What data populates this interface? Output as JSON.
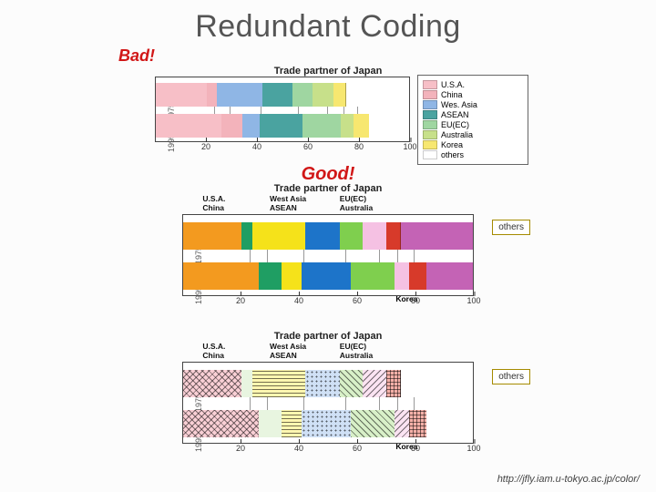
{
  "title": "Redundant Coding",
  "bad_label": "Bad!",
  "good_label": "Good!",
  "footer_url": "http://jfly.iam.u-tokyo.ac.jp/color/",
  "panel1": {
    "title": "Trade partner of Japan",
    "ylabels": [
      "1975",
      "1995"
    ],
    "ticks": [
      "20",
      "40",
      "60",
      "80",
      "100"
    ],
    "legend": [
      "U.S.A.",
      "China",
      "Wes. Asia",
      "ASEAN",
      "EU(EC)",
      "Australia",
      "Korea",
      "others"
    ]
  },
  "panel2": {
    "title": "Trade partner of Japan",
    "ylabels": [
      "1975",
      "1995"
    ],
    "ticks": [
      "20",
      "40",
      "60",
      "80",
      "100"
    ],
    "top_labels": {
      "t1a": "U.S.A.",
      "t1b": "China",
      "t2a": "West Asia",
      "t2b": "ASEAN",
      "t3a": "EU(EC)",
      "t3b": "Australia"
    },
    "bottom_label": "Korea",
    "others": "others"
  },
  "panel3": {
    "title": "Trade partner of Japan",
    "ylabels": [
      "1975",
      "1995"
    ],
    "ticks": [
      "20",
      "40",
      "60",
      "80",
      "100"
    ],
    "top_labels": {
      "t1a": "U.S.A.",
      "t1b": "China",
      "t2a": "West Asia",
      "t2b": "ASEAN",
      "t3a": "EU(EC)",
      "t3b": "Australia"
    },
    "bottom_label": "Korea",
    "others": "others"
  },
  "colors": {
    "usa": "#f7bfc7",
    "china": "#f3b3bb",
    "wasia": "#8fb6e5",
    "asean": "#4aa3a0",
    "eu": "#9fd6a1",
    "australia": "#c7e08a",
    "korea": "#f7e770",
    "others": "#fff"
  },
  "colors2": {
    "usa": "#f39a1f",
    "china": "#1f9e63",
    "wasia": "#f5e21a",
    "asean": "#1d74c9",
    "eu": "#7fcf4e",
    "australia": "#f5c1e3",
    "korea": "#d73a2a",
    "others": "#c463b5"
  },
  "colors3": {
    "usa": "#f9cfd5",
    "china": "#e8f5e0",
    "wasia": "#fff7b0",
    "asean": "#cfe0f5",
    "eu": "#d8f0c8",
    "australia": "#fbe3f2",
    "korea": "#f5b0a8",
    "others": "#fff"
  },
  "chart_data": [
    {
      "type": "bar",
      "subtype": "stacked-horizontal",
      "title": "Trade partner of Japan",
      "panel": "bad",
      "categories": [
        "1975",
        "1995"
      ],
      "x_ticks": [
        20,
        40,
        60,
        80,
        100
      ],
      "series_order": [
        "U.S.A.",
        "China",
        "Wes. Asia",
        "ASEAN",
        "EU(EC)",
        "Australia",
        "Korea",
        "others"
      ],
      "values": {
        "1975": [
          20,
          4,
          18,
          12,
          8,
          8,
          5,
          25
        ],
        "1995": [
          26,
          8,
          7,
          17,
          15,
          5,
          6,
          16
        ]
      },
      "xlim": [
        0,
        100
      ]
    },
    {
      "type": "bar",
      "subtype": "stacked-horizontal",
      "title": "Trade partner of Japan",
      "panel": "good_color",
      "categories": [
        "1975",
        "1995"
      ],
      "x_ticks": [
        20,
        40,
        60,
        80,
        100
      ],
      "series_order": [
        "U.S.A.",
        "China",
        "West Asia",
        "ASEAN",
        "EU(EC)",
        "Australia",
        "Korea",
        "others"
      ],
      "values": {
        "1975": [
          20,
          4,
          18,
          12,
          8,
          8,
          5,
          25
        ],
        "1995": [
          26,
          8,
          7,
          17,
          15,
          5,
          6,
          16
        ]
      },
      "xlim": [
        0,
        100
      ]
    },
    {
      "type": "bar",
      "subtype": "stacked-horizontal",
      "title": "Trade partner of Japan",
      "panel": "good_texture",
      "categories": [
        "1975",
        "1995"
      ],
      "x_ticks": [
        20,
        40,
        60,
        80,
        100
      ],
      "series_order": [
        "U.S.A.",
        "China",
        "West Asia",
        "ASEAN",
        "EU(EC)",
        "Australia",
        "Korea",
        "others"
      ],
      "values": {
        "1975": [
          20,
          4,
          18,
          12,
          8,
          8,
          5,
          25
        ],
        "1995": [
          26,
          8,
          7,
          17,
          15,
          5,
          6,
          16
        ]
      },
      "xlim": [
        0,
        100
      ]
    }
  ]
}
